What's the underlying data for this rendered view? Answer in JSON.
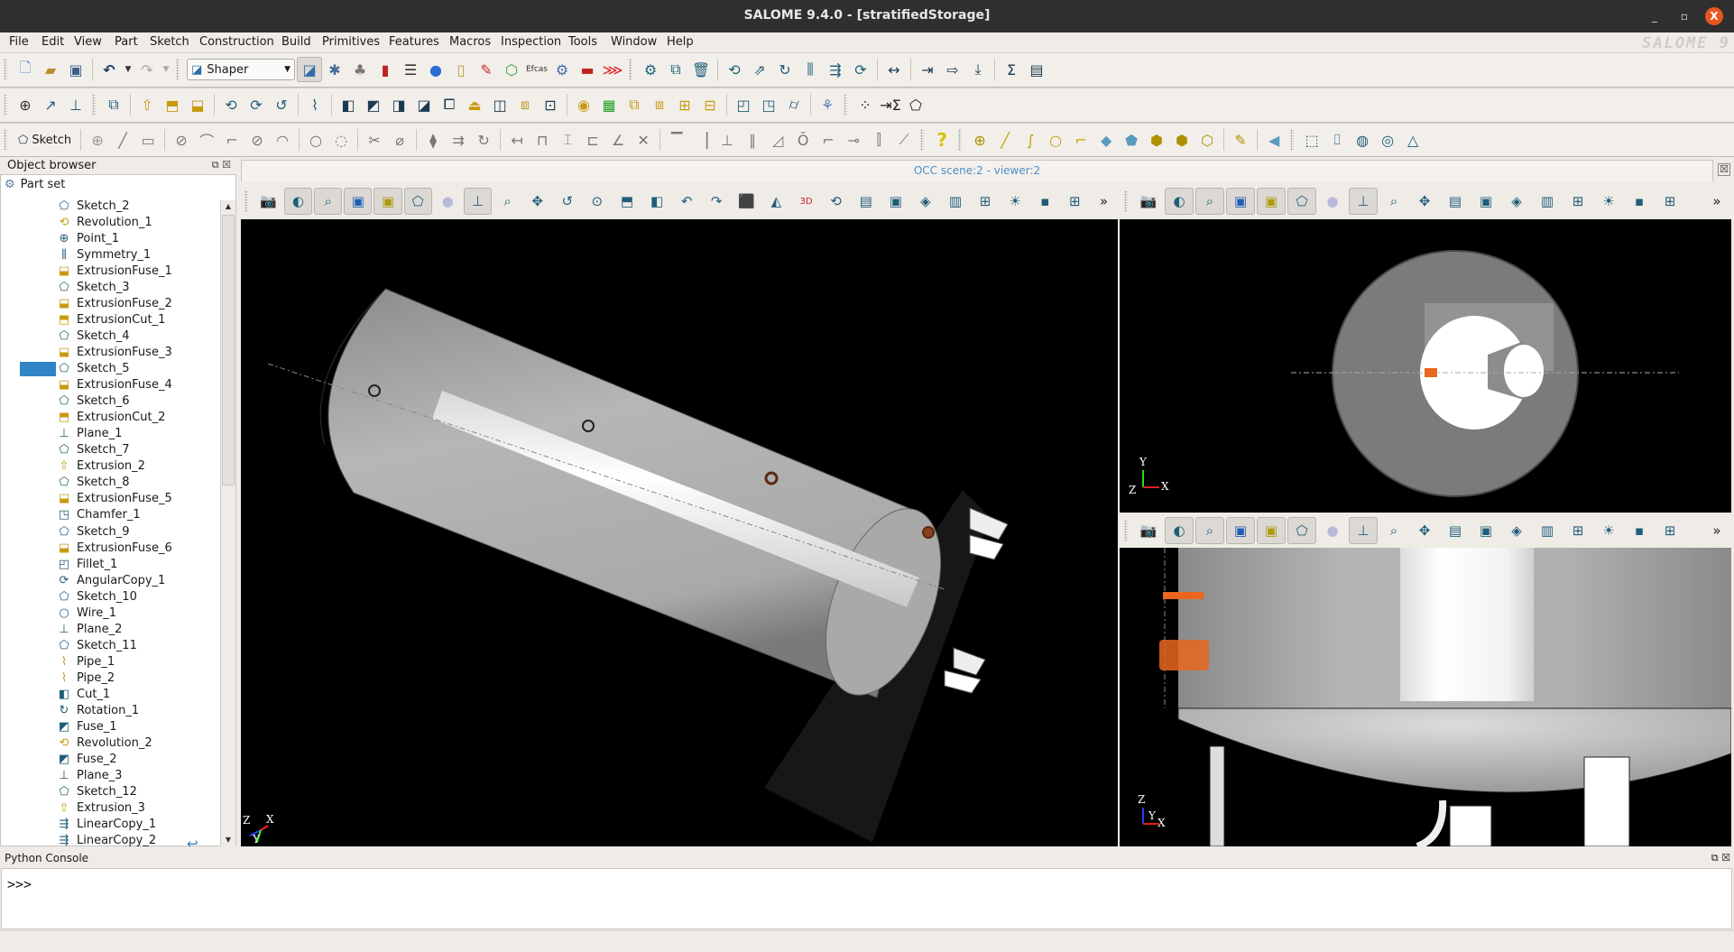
{
  "window": {
    "title": "SALOME  9.4.0 - [stratifiedStorage]",
    "minimize_glyph": "_",
    "maximize_glyph": "▫",
    "close_glyph": "X"
  },
  "menubar": {
    "items": [
      "File",
      "Edit",
      "View",
      "Part",
      "Sketch",
      "Construction",
      "Build",
      "Primitives",
      "Features",
      "Macros",
      "Inspection",
      "Tools",
      "Window",
      "Help"
    ],
    "logo_text": "SALOME 9"
  },
  "toolbar1": {
    "module_selector": {
      "value": "Shaper",
      "icon": "shaper-icon"
    },
    "file_icons": [
      "new-document-icon",
      "open-folder-icon",
      "save-icon"
    ],
    "undo_icon": "undo-icon",
    "redo_icon": "redo-icon",
    "module_icons": [
      "shaper-module-icon",
      "geometry-module-icon",
      "mesh-module-icon",
      "paravis-module-icon",
      "yacs-module-icon",
      "jobmanager-module-icon",
      "smesh-calculator-icon",
      "homard-module-icon",
      "hexablock-module-icon",
      "eficas-module-icon",
      "settings-gear-icon",
      "lobster-icon",
      "red-lobster-icon"
    ],
    "part_icons": [
      "parameters-gear-icon",
      "duplicate-icon",
      "delete-trash-icon",
      "placement-icon",
      "translation-icon",
      "rotation-icon",
      "symmetry-icon",
      "linear-copy-icon",
      "angular-copy-icon",
      "measurement-icon",
      "import-icon",
      "export-icon",
      "download-icon",
      "sum-icon",
      "parameters-list-icon"
    ]
  },
  "toolbar2": {
    "construction_icons": [
      "point-icon",
      "axis-icon",
      "plane-icon"
    ],
    "feature_icons": [
      "partition-icon",
      "extrusion-icon",
      "extrusion-cut-icon",
      "extrusion-fuse-icon",
      "revolution-icon",
      "revolution-cut-icon",
      "revolution-fuse-icon",
      "pipe-icon",
      "cut-icon",
      "fuse-icon",
      "common-icon",
      "smash-icon",
      "split-icon",
      "fill-icon",
      "intersection-icon",
      "union-icon",
      "remove-subshapes-icon",
      "recover-icon",
      "group-icon",
      "group-add-icon",
      "group-intersect-icon",
      "group-subtract-icon",
      "fillet-icon",
      "chamfer-icon",
      "fillet-multi-icon",
      "field-icon",
      "point-cloud-icon",
      "sum-param-icon",
      "sketch-outline-icon"
    ]
  },
  "toolbar3": {
    "sketch_button_label": "Sketch",
    "sketch_icons": [
      "sketch-point-icon",
      "sketch-line-icon",
      "sketch-rectangle-icon",
      "sketch-circle-icon",
      "sketch-arc-icon",
      "sketch-ellipse-arc-icon",
      "sketch-ellipse-icon",
      "sketch-tangent-arc-icon",
      "sketch-circle-3pt-icon",
      "sketch-arc-3pt-icon",
      "sketch-trim-icon",
      "sketch-split-icon",
      "sketch-mirror-icon",
      "sketch-translation-icon",
      "sketch-rotation-icon",
      "distance-constraint-icon",
      "horizontal-distance-icon",
      "vertical-distance-icon",
      "length-constraint-icon",
      "angle-constraint-icon",
      "intersection-point-icon",
      "horizontal-constraint-icon",
      "vertical-constraint-icon",
      "fixed-constraint-icon",
      "parallel-constraint-icon",
      "perpendicular-constraint-icon",
      "tangent-constraint-icon",
      "coincident-constraint-icon",
      "middle-point-icon",
      "equal-constraint-icon",
      "collinear-constraint-icon",
      "help-question-icon",
      "build-vertex-icon",
      "build-edge-icon",
      "build-wire-icon",
      "build-polyline-icon",
      "build-face-icon",
      "build-shell-icon",
      "build-solid-icon",
      "build-compsolid-icon",
      "build-compound-icon",
      "build-subshapes-icon",
      "build-interpolation-icon",
      "filling-icon",
      "box-icon",
      "cylinder-icon",
      "sphere-icon",
      "torus-icon",
      "cone-icon"
    ]
  },
  "object_browser": {
    "title": "Object browser",
    "float_glyph": "⧉",
    "close_glyph": "☒",
    "root_label": "Part set",
    "selected_index": 10,
    "items": [
      {
        "label": "Sketch_2",
        "icon": "sketch-icon"
      },
      {
        "label": "Revolution_1",
        "icon": "revolution-icon"
      },
      {
        "label": "Point_1",
        "icon": "point-icon"
      },
      {
        "label": "Symmetry_1",
        "icon": "symmetry-icon"
      },
      {
        "label": "ExtrusionFuse_1",
        "icon": "extrusion-fuse-icon"
      },
      {
        "label": "Sketch_3",
        "icon": "sketch-icon"
      },
      {
        "label": "ExtrusionFuse_2",
        "icon": "extrusion-fuse-icon"
      },
      {
        "label": "ExtrusionCut_1",
        "icon": "extrusion-cut-icon"
      },
      {
        "label": "Sketch_4",
        "icon": "sketch-icon"
      },
      {
        "label": "ExtrusionFuse_3",
        "icon": "extrusion-fuse-icon"
      },
      {
        "label": "Sketch_5",
        "icon": "sketch-icon"
      },
      {
        "label": "ExtrusionFuse_4",
        "icon": "extrusion-fuse-icon"
      },
      {
        "label": "Sketch_6",
        "icon": "sketch-icon"
      },
      {
        "label": "ExtrusionCut_2",
        "icon": "extrusion-cut-icon"
      },
      {
        "label": "Plane_1",
        "icon": "plane-icon"
      },
      {
        "label": "Sketch_7",
        "icon": "sketch-icon"
      },
      {
        "label": "Extrusion_2",
        "icon": "extrusion-icon"
      },
      {
        "label": "Sketch_8",
        "icon": "sketch-icon"
      },
      {
        "label": "ExtrusionFuse_5",
        "icon": "extrusion-fuse-icon"
      },
      {
        "label": "Chamfer_1",
        "icon": "chamfer-icon"
      },
      {
        "label": "Sketch_9",
        "icon": "sketch-icon"
      },
      {
        "label": "ExtrusionFuse_6",
        "icon": "extrusion-fuse-icon"
      },
      {
        "label": "Fillet_1",
        "icon": "fillet-icon"
      },
      {
        "label": "AngularCopy_1",
        "icon": "angular-copy-icon"
      },
      {
        "label": "Sketch_10",
        "icon": "sketch-icon"
      },
      {
        "label": "Wire_1",
        "icon": "wire-icon"
      },
      {
        "label": "Plane_2",
        "icon": "plane-icon"
      },
      {
        "label": "Sketch_11",
        "icon": "sketch-icon"
      },
      {
        "label": "Pipe_1",
        "icon": "pipe-icon"
      },
      {
        "label": "Pipe_2",
        "icon": "pipe-icon"
      },
      {
        "label": "Cut_1",
        "icon": "cut-icon"
      },
      {
        "label": "Rotation_1",
        "icon": "rotation-icon"
      },
      {
        "label": "Fuse_1",
        "icon": "fuse-icon"
      },
      {
        "label": "Revolution_2",
        "icon": "revolution-icon"
      },
      {
        "label": "Fuse_2",
        "icon": "fuse-icon"
      },
      {
        "label": "Plane_3",
        "icon": "plane-icon"
      },
      {
        "label": "Sketch_12",
        "icon": "sketch-icon"
      },
      {
        "label": "Extrusion_3",
        "icon": "extrusion-icon"
      },
      {
        "label": "LinearCopy_1",
        "icon": "linear-copy-icon"
      },
      {
        "label": "LinearCopy_2",
        "icon": "linear-copy-icon"
      }
    ],
    "history_arrow_icon": "history-rollback-icon"
  },
  "viewer": {
    "scene_title": "OCC scene:2 - viewer:2",
    "close_glyph": "☒",
    "toolbar_icons": [
      "dump-view-icon",
      "interaction-style-icon",
      "zooming-style-icon",
      "rectangle-selection-icon",
      "polygon-selection-icon",
      "polygon-icon",
      "circle-selection-icon",
      "show-trihedron-icon",
      "fit-all-icon",
      "pan-icon",
      "rotate-icon",
      "global-pan-icon",
      "fit-area-icon",
      "front-view-icon",
      "rotate-anticlockwise-icon",
      "rotate-clockwise-icon",
      "reset-view-icon",
      "projection-mode-icon",
      "stereo-3d-icon",
      "rotation-point-icon",
      "memorize-view-icon",
      "clone-view-icon",
      "clipping-icon",
      "scaling-icon",
      "graduated-axes-icon",
      "ambient-light-icon",
      "background-icon",
      "split-view-icon"
    ],
    "more_glyph": "»",
    "views": [
      {
        "name": "main-3d-view",
        "axes": [
          "Z",
          "X",
          "Y"
        ]
      },
      {
        "name": "top-view",
        "axes": [
          "Y",
          "Z",
          "X"
        ]
      },
      {
        "name": "front-view",
        "axes": [
          "Z",
          "Y",
          "X"
        ]
      }
    ]
  },
  "python_console": {
    "title": "Python Console",
    "prompt": ">>>",
    "float_glyph": "⧉",
    "close_glyph": "☒"
  },
  "colors": {
    "titlebar": "#2f2f2f",
    "close_button": "#e95420",
    "selection": "#3085c6",
    "scene_title": "#4d8fc6",
    "viewport_bg": "#000000",
    "tank_gray": "#a8a8a8",
    "pipe_orange": "#e8661e"
  }
}
